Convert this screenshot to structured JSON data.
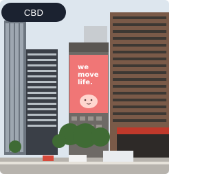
{
  "location_chip": {
    "label": "CBD"
  },
  "billboard": {
    "lines": [
      "we",
      "move",
      "life."
    ],
    "color": "#f07676"
  },
  "colors": {
    "sky": "#dfe7ef",
    "chip_bg": "#1b2230",
    "chip_text": "#ffffff"
  }
}
